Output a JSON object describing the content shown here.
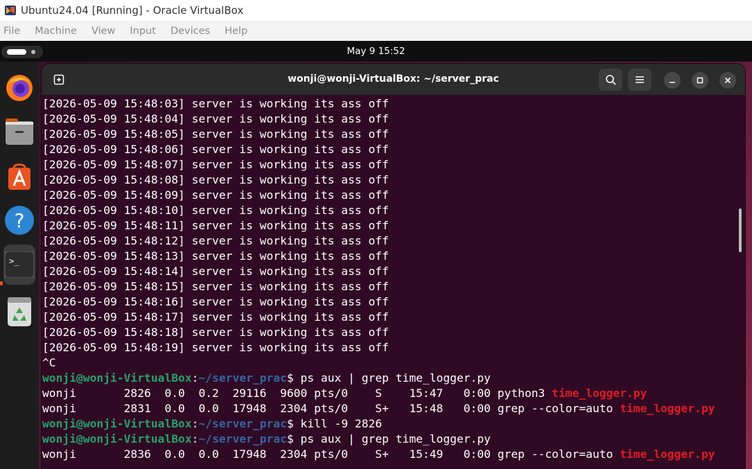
{
  "vbox": {
    "title": "Ubuntu24.04 [Running] - Oracle VirtualBox",
    "menu": [
      "File",
      "Machine",
      "View",
      "Input",
      "Devices",
      "Help"
    ]
  },
  "topbar": {
    "clock": "May 9  15:52"
  },
  "dock": {
    "items": [
      "firefox-icon",
      "files-icon",
      "app-center-icon",
      "help-icon",
      "terminal-icon",
      "trash-icon"
    ],
    "active": "terminal-icon",
    "accent": "#e95420"
  },
  "terminal": {
    "title": "wonji@wonji-VirtualBox: ~/server_prac",
    "colors": {
      "background": "#300a24",
      "prompt_user": "#26a269",
      "prompt_path": "#3465a4",
      "grep_match": "#e01b24"
    },
    "log_lines": [
      "[2026-05-09 15:48:03] server is working its ass off",
      "[2026-05-09 15:48:04] server is working its ass off",
      "[2026-05-09 15:48:05] server is working its ass off",
      "[2026-05-09 15:48:06] server is working its ass off",
      "[2026-05-09 15:48:07] server is working its ass off",
      "[2026-05-09 15:48:08] server is working its ass off",
      "[2026-05-09 15:48:09] server is working its ass off",
      "[2026-05-09 15:48:10] server is working its ass off",
      "[2026-05-09 15:48:11] server is working its ass off",
      "[2026-05-09 15:48:12] server is working its ass off",
      "[2026-05-09 15:48:13] server is working its ass off",
      "[2026-05-09 15:48:14] server is working its ass off",
      "[2026-05-09 15:48:15] server is working its ass off",
      "[2026-05-09 15:48:16] server is working its ass off",
      "[2026-05-09 15:48:17] server is working its ass off",
      "[2026-05-09 15:48:18] server is working its ass off",
      "[2026-05-09 15:48:19] server is working its ass off"
    ],
    "interrupt": "^C",
    "prompt": {
      "user": "wonji@wonji-VirtualBox",
      "sep": ":",
      "path": "~/server_prac",
      "symbol": "$ "
    },
    "cmd1": "ps aux | grep time_logger.py",
    "ps1_row1": {
      "pre": "wonji       2826  0.0  0.2  29116  9600 pts/0    S    15:47   0:00 python3 ",
      "match": "time_logger.py"
    },
    "ps1_row2": {
      "pre": "wonji       2831  0.0  0.0  17948  2304 pts/0    S+   15:48   0:00 grep --color=auto ",
      "match": "time_logger.py"
    },
    "cmd2": "kill -9 2826",
    "cmd3": "ps aux | grep time_logger.py",
    "ps2_row1": {
      "pre": "wonji       2836  0.0  0.0  17948  2304 pts/0    S+   15:49   0:00 grep --color=auto ",
      "match": "time_logger.py"
    }
  }
}
